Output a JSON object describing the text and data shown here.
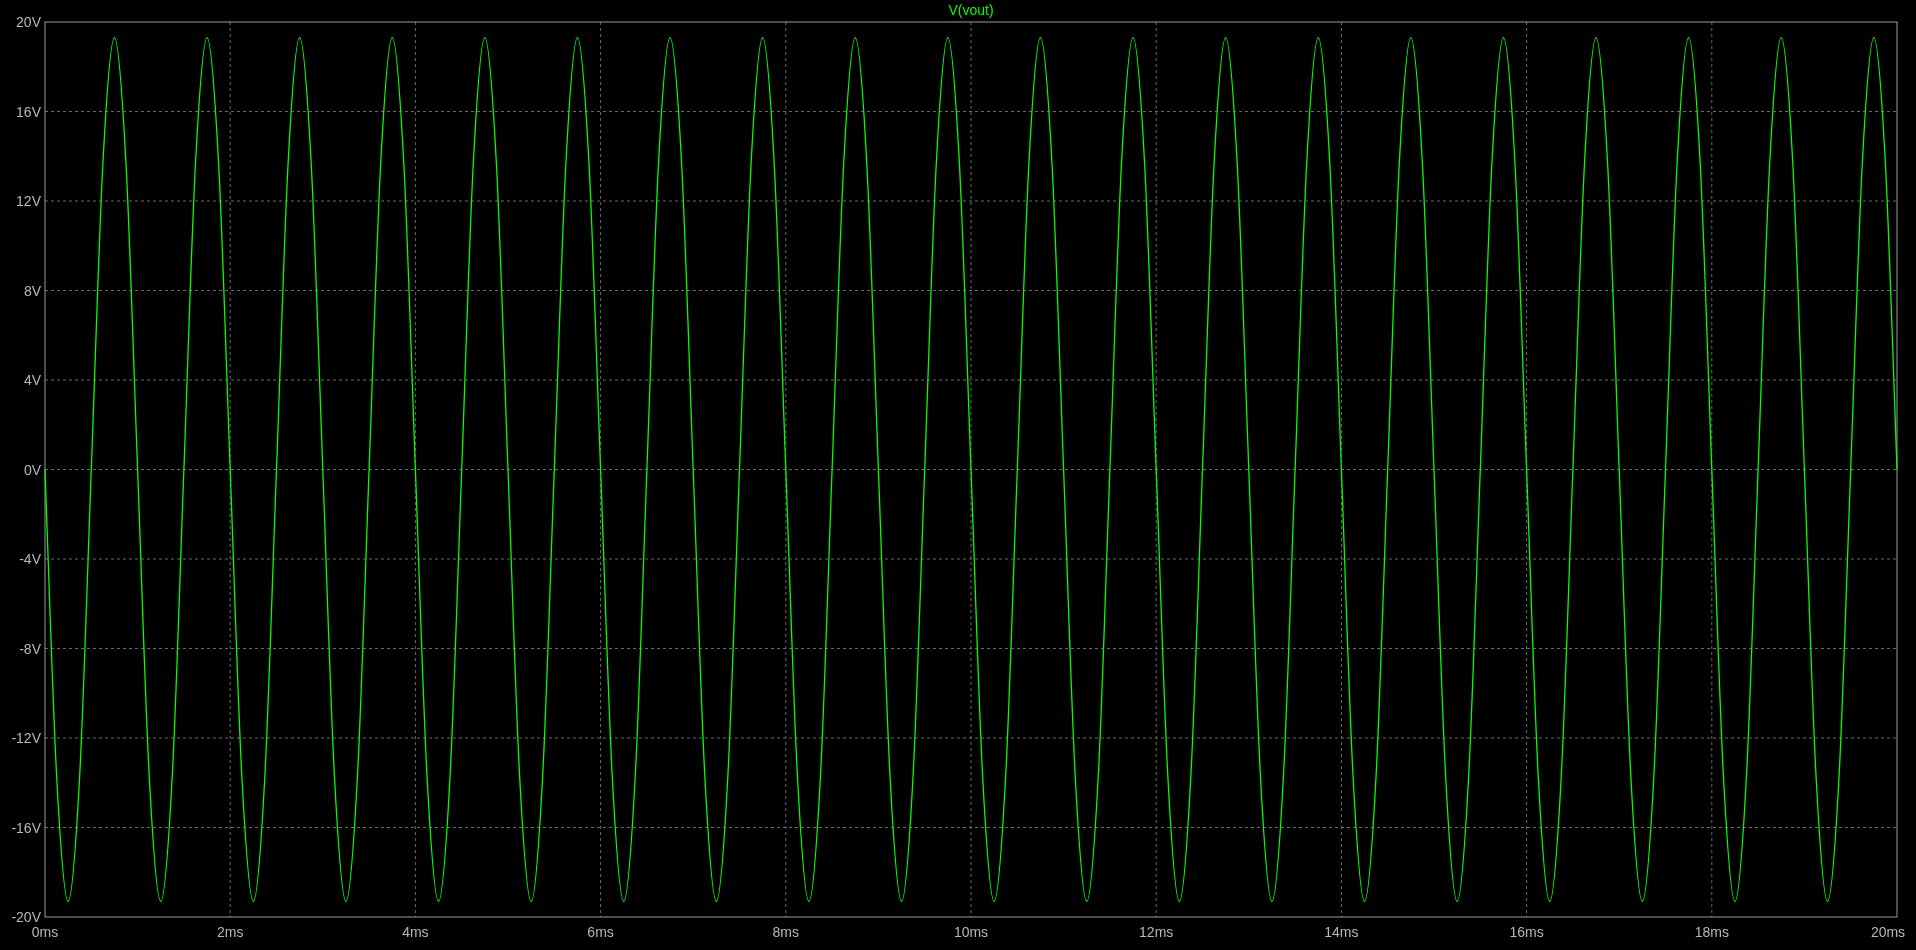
{
  "chart_data": {
    "type": "line",
    "grid": true,
    "xlim": [
      0,
      20
    ],
    "ylim": [
      -20,
      20
    ],
    "xticks": [
      {
        "value": 0,
        "label": "0ms"
      },
      {
        "value": 2,
        "label": "2ms"
      },
      {
        "value": 4,
        "label": "4ms"
      },
      {
        "value": 6,
        "label": "6ms"
      },
      {
        "value": 8,
        "label": "8ms"
      },
      {
        "value": 10,
        "label": "10ms"
      },
      {
        "value": 12,
        "label": "12ms"
      },
      {
        "value": 14,
        "label": "14ms"
      },
      {
        "value": 16,
        "label": "16ms"
      },
      {
        "value": 18,
        "label": "18ms"
      },
      {
        "value": 20,
        "label": "20ms"
      }
    ],
    "yticks": [
      {
        "value": 20,
        "label": "20V"
      },
      {
        "value": 16,
        "label": "16V"
      },
      {
        "value": 12,
        "label": "12V"
      },
      {
        "value": 8,
        "label": "8V"
      },
      {
        "value": 4,
        "label": "4V"
      },
      {
        "value": 0,
        "label": "0V"
      },
      {
        "value": -4,
        "label": "-4V"
      },
      {
        "value": -8,
        "label": "-8V"
      },
      {
        "value": -12,
        "label": "-12V"
      },
      {
        "value": -16,
        "label": "-16V"
      },
      {
        "value": -20,
        "label": "-20V"
      }
    ],
    "x": [
      0,
      0.125,
      0.25,
      0.375,
      0.5,
      0.625,
      0.75,
      0.875,
      1,
      1.125,
      1.25,
      1.375,
      1.5,
      1.625,
      1.75,
      1.875,
      2,
      2.125,
      2.25,
      2.375,
      2.5,
      2.625,
      2.75,
      2.875,
      3,
      3.125,
      3.25,
      3.375,
      3.5,
      3.625,
      3.75,
      3.875,
      4,
      4.125,
      4.25,
      4.375,
      4.5,
      4.625,
      4.75,
      4.875,
      5,
      5.125,
      5.25,
      5.375,
      5.5,
      5.625,
      5.75,
      5.875,
      6,
      6.125,
      6.25,
      6.375,
      6.5,
      6.625,
      6.75,
      6.875,
      7,
      7.125,
      7.25,
      7.375,
      7.5,
      7.625,
      7.75,
      7.875,
      8,
      8.125,
      8.25,
      8.375,
      8.5,
      8.625,
      8.75,
      8.875,
      9,
      9.125,
      9.25,
      9.375,
      9.5,
      9.625,
      9.75,
      9.875,
      10,
      10.125,
      10.25,
      10.375,
      10.5,
      10.625,
      10.75,
      10.875,
      11,
      11.125,
      11.25,
      11.375,
      11.5,
      11.625,
      11.75,
      11.875,
      12,
      12.125,
      12.25,
      12.375,
      12.5,
      12.625,
      12.75,
      12.875,
      13,
      13.125,
      13.25,
      13.375,
      13.5,
      13.625,
      13.75,
      13.875,
      14,
      14.125,
      14.25,
      14.375,
      14.5,
      14.625,
      14.75,
      14.875,
      15,
      15.125,
      15.25,
      15.375,
      15.5,
      15.625,
      15.75,
      15.875,
      16,
      16.125,
      16.25,
      16.375,
      16.5,
      16.625,
      16.75,
      16.875,
      17,
      17.125,
      17.25,
      17.375,
      17.5,
      17.625,
      17.75,
      17.875,
      18,
      18.125,
      18.25,
      18.375,
      18.5,
      18.625,
      18.75,
      18.875,
      19,
      19.125,
      19.25,
      19.375,
      19.5,
      19.625,
      19.75,
      19.875,
      20
    ],
    "series": [
      {
        "name": "V(vout)",
        "color": "#00ff00",
        "values": [
          0,
          -13.65,
          -19.3,
          -13.65,
          0,
          13.65,
          19.3,
          13.65,
          0,
          -13.65,
          -19.3,
          -13.65,
          0,
          13.65,
          19.3,
          13.65,
          0,
          -13.65,
          -19.3,
          -13.65,
          0,
          13.65,
          19.3,
          13.65,
          0,
          -13.65,
          -19.3,
          -13.65,
          0,
          13.65,
          19.3,
          13.65,
          0,
          -13.65,
          -19.3,
          -13.65,
          0,
          13.65,
          19.3,
          13.65,
          0,
          -13.65,
          -19.3,
          -13.65,
          0,
          13.65,
          19.3,
          13.65,
          0,
          -13.65,
          -19.3,
          -13.65,
          0,
          13.65,
          19.3,
          13.65,
          0,
          -13.65,
          -19.3,
          -13.65,
          0,
          13.65,
          19.3,
          13.65,
          0,
          -13.65,
          -19.3,
          -13.65,
          0,
          13.65,
          19.3,
          13.65,
          0,
          -13.65,
          -19.3,
          -13.65,
          0,
          13.65,
          19.3,
          13.65,
          0,
          -13.65,
          -19.3,
          -13.65,
          0,
          13.65,
          19.3,
          13.65,
          0,
          -13.65,
          -19.3,
          -13.65,
          0,
          13.65,
          19.3,
          13.65,
          0,
          -13.65,
          -19.3,
          -13.65,
          0,
          13.65,
          19.3,
          13.65,
          0,
          -13.65,
          -19.3,
          -13.65,
          0,
          13.65,
          19.3,
          13.65,
          0,
          -13.65,
          -19.3,
          -13.65,
          0,
          13.65,
          19.3,
          13.65,
          0,
          -13.65,
          -19.3,
          -13.65,
          0,
          13.65,
          19.3,
          13.65,
          0,
          -13.65,
          -19.3,
          -13.65,
          0,
          13.65,
          19.3,
          13.65,
          0,
          -13.65,
          -19.3,
          -13.65,
          0,
          13.65,
          19.3,
          13.65,
          0,
          -13.65,
          -19.3,
          -13.65,
          0,
          13.65,
          19.3,
          13.65,
          0,
          -13.65,
          -19.3,
          -13.65,
          0,
          13.65,
          19.3,
          13.65,
          0
        ]
      }
    ]
  }
}
